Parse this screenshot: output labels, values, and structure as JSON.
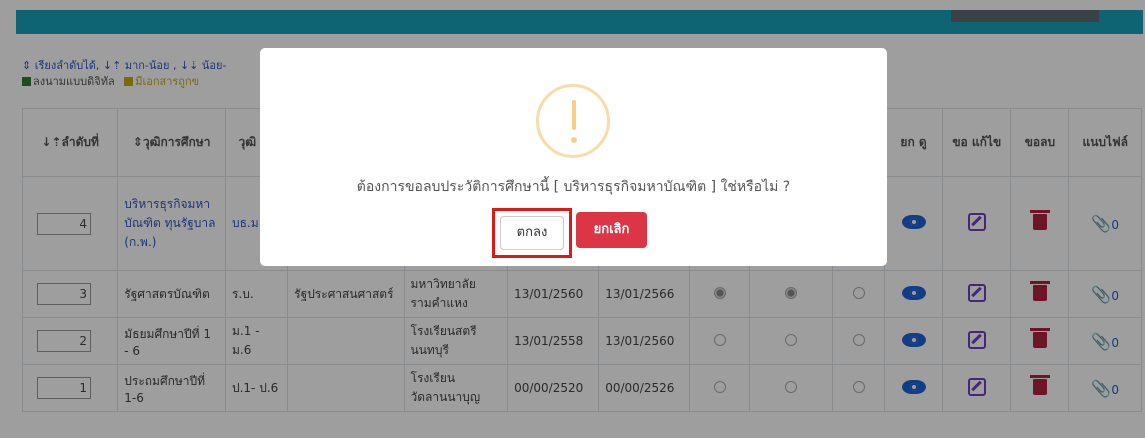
{
  "legend": {
    "sort_hint": "⇕ เรียงลำดับได้, ↓⇡ มาก-น้อย , ↓⇣ น้อย-",
    "digital_sign": "ลงนามแบบดิจิทัล",
    "doc_label": "มีเอกสารถูกข"
  },
  "table": {
    "headers": {
      "order": "↓⇡ลำดับที่",
      "degree": "⇕วุฒิการศึกษา",
      "abbr": "วุฒิ ย่อ",
      "request": "ยก ดู",
      "edit": "ขอ แก้ไข",
      "delete": "ขอลบ",
      "attach": "แนบไฟล์"
    },
    "rows": [
      {
        "order": "4",
        "degree": "บริหารธุรกิจมหาบัณฑิต ทุนรัฐบาล (ก.พ.)",
        "abbr": "บธ.ม",
        "major": "",
        "institution": "",
        "start": "",
        "end": "",
        "attach_count": "0"
      },
      {
        "order": "3",
        "degree": "รัฐศาสตรบัณฑิต",
        "abbr": "ร.บ.",
        "major": "รัฐประศาสนศาสตร์",
        "institution": "มหาวิทยาลัยรามคำแหง",
        "start": "13/01/2560",
        "end": "13/01/2566",
        "attach_count": "0"
      },
      {
        "order": "2",
        "degree": "มัธยมศึกษาปีที่ 1 - 6",
        "abbr": "ม.1 - ม.6",
        "major": "",
        "institution": "โรงเรียนสตรีนนทบุรี",
        "start": "13/01/2558",
        "end": "13/01/2560",
        "attach_count": "0"
      },
      {
        "order": "1",
        "degree": "ประถมศึกษาปีที่ 1-6",
        "abbr": "ป.1- ป.6",
        "major": "",
        "institution": "โรงเรียนวัดลานนาบุญ",
        "start": "00/00/2520",
        "end": "00/00/2526",
        "attach_count": "0"
      }
    ]
  },
  "modal": {
    "message": "ต้องการขอลบประวัติการศึกษานี้ [ บริหารธุรกิจมหาบัณฑิต ] ใช่หรือไม่ ?",
    "ok_label": "ตกลง",
    "cancel_label": "ยกเลิก"
  }
}
